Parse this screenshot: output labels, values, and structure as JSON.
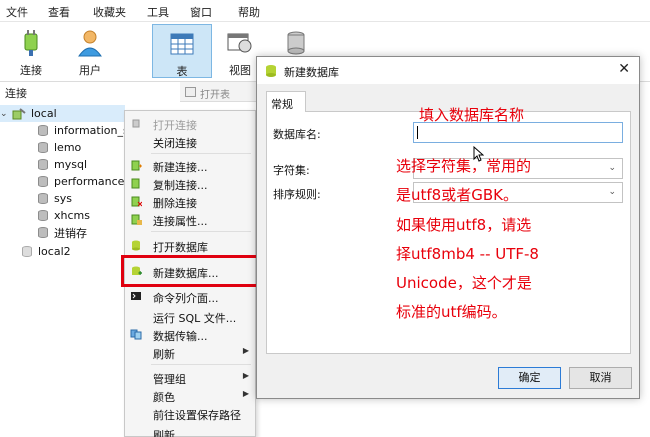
{
  "menubar": {
    "items": [
      "文件",
      "查看",
      "收藏夹",
      "工具",
      "窗口",
      "帮助"
    ]
  },
  "toolbar": {
    "connect": "连接",
    "user": "用户",
    "table": "表",
    "view": "视图"
  },
  "sidebar": {
    "header": "连接",
    "open_table": "打开表",
    "connections": [
      {
        "name": "local",
        "databases": [
          "information_s",
          "lemo",
          "mysql",
          "performance_",
          "sys",
          "xhcms",
          "进销存"
        ]
      },
      {
        "name": "local2"
      }
    ]
  },
  "context_menu": {
    "items": [
      {
        "label": "打开连接",
        "enabled": false
      },
      {
        "label": "关闭连接"
      },
      {
        "label": "新建连接..."
      },
      {
        "label": "复制连接..."
      },
      {
        "label": "删除连接"
      },
      {
        "label": "连接属性..."
      },
      {
        "label": "打开数据库"
      },
      {
        "label": "新建数据库...",
        "highlighted": true
      },
      {
        "label": "命令列介面..."
      },
      {
        "label": "运行 SQL 文件..."
      },
      {
        "label": "数据传输..."
      },
      {
        "label": "刷新",
        "submenu": true
      },
      {
        "label": "管理组",
        "submenu": true
      },
      {
        "label": "颜色",
        "submenu": true
      },
      {
        "label": "前往设置保存路径"
      },
      {
        "label": "刷新"
      }
    ]
  },
  "dialog": {
    "title": "新建数据库",
    "close_glyph": "✕",
    "tab": "常规",
    "fields": {
      "db_name_label": "数据库名:",
      "db_name_value": "",
      "charset_label": "字符集:",
      "charset_value": "",
      "collation_label": "排序规则:",
      "collation_value": ""
    },
    "ok": "确定",
    "cancel": "取消"
  },
  "annotations": {
    "fill_name": "填入数据库名称",
    "lines": [
      "选择字符集，常用的",
      "是utf8或者GBK。",
      "如果使用utf8，请选",
      "择utf8mb4 -- UTF-8",
      "Unicode，这个才是",
      "标准的utf编码。"
    ]
  },
  "colors": {
    "annotation": "#e8000b",
    "selected_toolbar": "#cde6f7",
    "highlight_box": "#e0000f"
  }
}
